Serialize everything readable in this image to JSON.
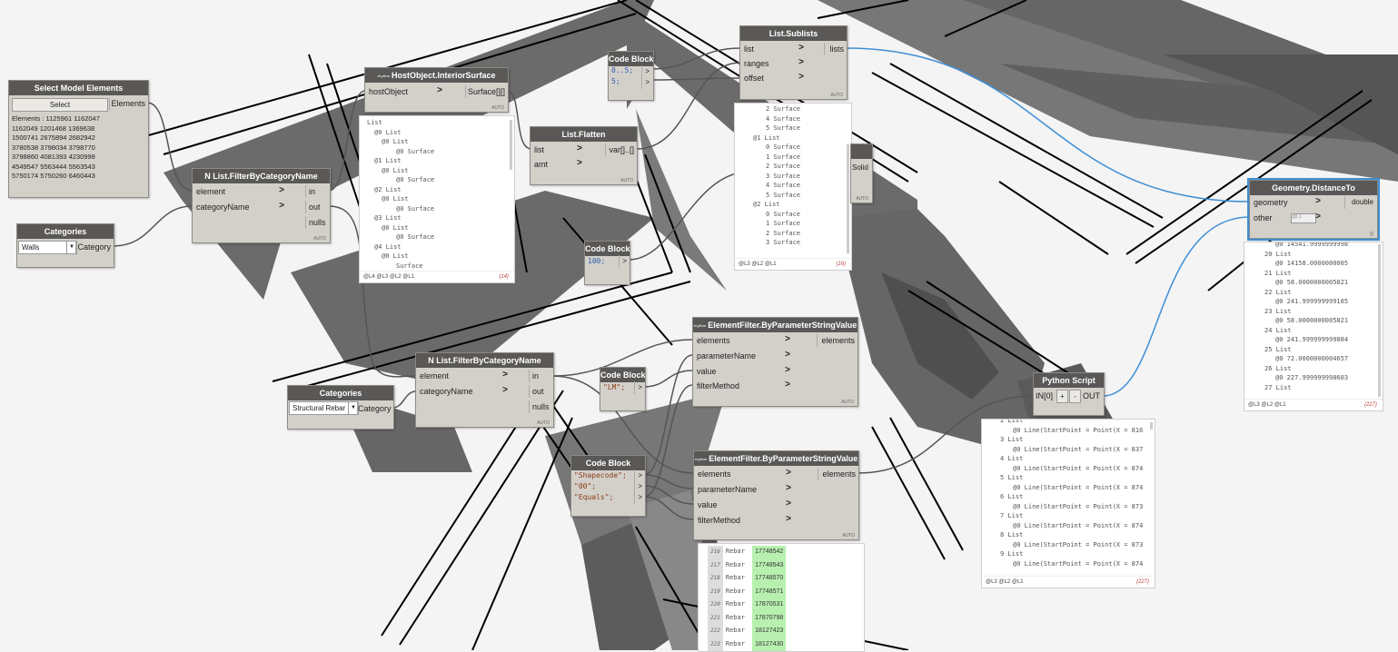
{
  "nodes": {
    "select_model": {
      "title": "Select Model Elements",
      "button": "Select",
      "output": "Elements",
      "info": "Elements : 1125961 1162047 1162049 1201468 1369638 1500741 2675894 2682942 3780538 3798034 3798770 3798860 4081393 4230998 4549547 5563444 5563543 5750174 5750260 6460443"
    },
    "categories_1": {
      "title": "Categories",
      "value": "Walls",
      "output": "Category"
    },
    "categories_2": {
      "title": "Categories",
      "value": "Structural Rebar",
      "output": "Category"
    },
    "filter_cat_1": {
      "title": "List.FilterByCategoryName",
      "inputs": [
        "element",
        "categoryName"
      ],
      "outputs": [
        "in",
        "out",
        "nulls"
      ],
      "lacing": "AUTO"
    },
    "filter_cat_2": {
      "title": "List.FilterByCategoryName",
      "inputs": [
        "element",
        "categoryName"
      ],
      "outputs": [
        "in",
        "out",
        "nulls"
      ],
      "lacing": "AUTO"
    },
    "interior_surface": {
      "title": "HostObject.InteriorSurface",
      "input": "hostObject",
      "output": "Surface[][]",
      "lacing": "AUTO"
    },
    "code_block_1": {
      "title": "Code Block",
      "lines": [
        "0..5;",
        "5;"
      ]
    },
    "list_flatten": {
      "title": "List.Flatten",
      "inputs": [
        "list",
        "amt"
      ],
      "output": "var[]..[]",
      "lacing": "AUTO"
    },
    "code_block_2": {
      "title": "Code Block",
      "lines": [
        "100;"
      ]
    },
    "list_sublists": {
      "title": "List.Sublists",
      "inputs": [
        "list",
        "ranges",
        "offset"
      ],
      "output": "lists",
      "lacing": "AUTO"
    },
    "geometry_distance": {
      "title": "Geometry.DistanceTo",
      "inputs": [
        "geometry",
        "other"
      ],
      "output": "double",
      "lacing": "|||"
    },
    "elem_filter_1": {
      "title": "ElementFilter.ByParameterStringValue",
      "inputs": [
        "elements",
        "parameterName",
        "value",
        "filterMethod"
      ],
      "output": "elements",
      "lacing": "AUTO"
    },
    "elem_filter_2": {
      "title": "ElementFilter.ByParameterStringValue",
      "inputs": [
        "elements",
        "parameterName",
        "value",
        "filterMethod"
      ],
      "output": "elements",
      "lacing": "AUTO"
    },
    "code_block_3": {
      "title": "Code Block",
      "lines": [
        "\"LM\";"
      ]
    },
    "code_block_4": {
      "title": "Code Block",
      "lines": [
        "\"Shapecode\";",
        "\"00\";",
        "\"Equals\";"
      ]
    },
    "python_script": {
      "title": "Python Script",
      "input": "IN[0]",
      "add": "+",
      "remove": "-",
      "output": "OUT"
    },
    "hidden_solid": {
      "output": "Solid",
      "lacing": "AUTO"
    }
  },
  "previews": {
    "interior_surface": {
      "lines": [
        "List",
        "@0 List",
        "@0 List",
        "@0 Surface",
        "@1 List",
        "@0 List",
        "@0 Surface",
        "@2 List",
        "@0 List",
        "@0 Surface",
        "@3 List",
        "@0 List",
        "@0 Surface",
        "@4 List",
        "@0 List",
        "Surface"
      ],
      "levels": "@L4 @L3 @L2 @L1",
      "count": "{14}"
    },
    "sublists": {
      "lines": [
        "2 Surface",
        "4 Surface",
        "5 Surface",
        "@1 List",
        "0 Surface",
        "1 Surface",
        "2 Surface",
        "3 Surface",
        "4 Surface",
        "5 Surface",
        "@2 List",
        "0 Surface",
        "1 Surface",
        "2 Surface",
        "3 Surface"
      ],
      "levels": "@L3 @L2 @L1",
      "count": "{16}"
    },
    "distance": {
      "lines": [
        "@0 14541.9999999998",
        "20 List",
        "@0 14158.0000000005",
        "21 List",
        "@0 58.0000000005821",
        "22 List",
        "@0 241.999999999185",
        "23 List",
        "@0 58.0000000005821",
        "24 List",
        "@0 241.999999999884",
        "25 List",
        "@0 72.0000000004657",
        "26 List",
        "@0 227.999999998603",
        "27 List"
      ],
      "levels": "@L3 @L2 @L1",
      "count": "{227}"
    },
    "python": {
      "lines": [
        "2 List",
        "@0 Line(StartPoint = Point(X = 816",
        "3 List",
        "@0 Line(StartPoint = Point(X = 837",
        "4 List",
        "@0 Line(StartPoint = Point(X = 874",
        "5 List",
        "@0 Line(StartPoint = Point(X = 874",
        "6 List",
        "@0 Line(StartPoint = Point(X = 873",
        "7 List",
        "@0 Line(StartPoint = Point(X = 874",
        "8 List",
        "@0 Line(StartPoint = Point(X = 873",
        "9 List",
        "@0 Line(StartPoint = Point(X = 874"
      ],
      "levels": "@L3 @L2 @L1",
      "count": "{227}"
    },
    "rebar": {
      "rows": [
        {
          "idx": "216",
          "label": "Rebar",
          "id": "17748542"
        },
        {
          "idx": "217",
          "label": "Rebar",
          "id": "17748543"
        },
        {
          "idx": "218",
          "label": "Rebar",
          "id": "17748570"
        },
        {
          "idx": "219",
          "label": "Rebar",
          "id": "17748571"
        },
        {
          "idx": "220",
          "label": "Rebar",
          "id": "17870531"
        },
        {
          "idx": "221",
          "label": "Rebar",
          "id": "17870798"
        },
        {
          "idx": "222",
          "label": "Rebar",
          "id": "18127423"
        },
        {
          "idx": "223",
          "label": "Rebar",
          "id": "18127430"
        }
      ]
    }
  },
  "rhythm_badge": "rhythm",
  "colors": {
    "node_header": "#5a5856",
    "node_body": "#d3d0ca",
    "wire": "#555555",
    "wire_selected": "#3d8fd6",
    "rebar_id_bg": "#b8f0b0"
  }
}
